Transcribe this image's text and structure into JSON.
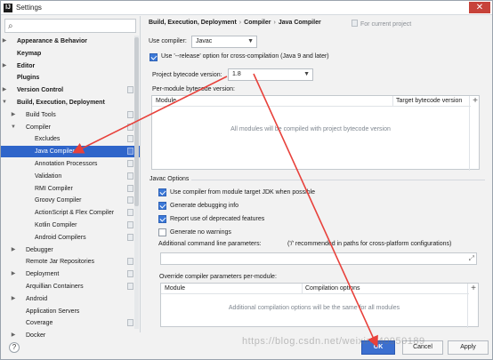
{
  "window": {
    "title": "Settings",
    "app_icon": "intellij-icon",
    "close_icon": "close-icon"
  },
  "sidebar": {
    "search_icon": "search-icon",
    "items": [
      {
        "label": "Appearance & Behavior",
        "level": 0,
        "arrow": "right",
        "bold": true,
        "project": false
      },
      {
        "label": "Keymap",
        "level": 0,
        "arrow": "",
        "bold": true,
        "project": false
      },
      {
        "label": "Editor",
        "level": 0,
        "arrow": "right",
        "bold": true,
        "project": false
      },
      {
        "label": "Plugins",
        "level": 0,
        "arrow": "",
        "bold": true,
        "project": false
      },
      {
        "label": "Version Control",
        "level": 0,
        "arrow": "right",
        "bold": true,
        "project": true
      },
      {
        "label": "Build, Execution, Deployment",
        "level": 0,
        "arrow": "down",
        "bold": true,
        "project": false
      },
      {
        "label": "Build Tools",
        "level": 1,
        "arrow": "right",
        "bold": false,
        "project": true
      },
      {
        "label": "Compiler",
        "level": 1,
        "arrow": "down",
        "bold": false,
        "project": true
      },
      {
        "label": "Excludes",
        "level": 2,
        "arrow": "",
        "bold": false,
        "project": true
      },
      {
        "label": "Java Compiler",
        "level": 2,
        "arrow": "",
        "bold": false,
        "project": true,
        "selected": true
      },
      {
        "label": "Annotation Processors",
        "level": 2,
        "arrow": "",
        "bold": false,
        "project": true
      },
      {
        "label": "Validation",
        "level": 2,
        "arrow": "",
        "bold": false,
        "project": true
      },
      {
        "label": "RMI Compiler",
        "level": 2,
        "arrow": "",
        "bold": false,
        "project": true
      },
      {
        "label": "Groovy Compiler",
        "level": 2,
        "arrow": "",
        "bold": false,
        "project": true
      },
      {
        "label": "ActionScript & Flex Compiler",
        "level": 2,
        "arrow": "",
        "bold": false,
        "project": true
      },
      {
        "label": "Kotlin Compiler",
        "level": 2,
        "arrow": "",
        "bold": false,
        "project": true
      },
      {
        "label": "Android Compilers",
        "level": 2,
        "arrow": "",
        "bold": false,
        "project": true
      },
      {
        "label": "Debugger",
        "level": 1,
        "arrow": "right",
        "bold": false,
        "project": false
      },
      {
        "label": "Remote Jar Repositories",
        "level": 1,
        "arrow": "",
        "bold": false,
        "project": true
      },
      {
        "label": "Deployment",
        "level": 1,
        "arrow": "right",
        "bold": false,
        "project": true
      },
      {
        "label": "Arquillian Containers",
        "level": 1,
        "arrow": "",
        "bold": false,
        "project": true
      },
      {
        "label": "Android",
        "level": 1,
        "arrow": "right",
        "bold": false,
        "project": false
      },
      {
        "label": "Application Servers",
        "level": 1,
        "arrow": "",
        "bold": false,
        "project": false
      },
      {
        "label": "Coverage",
        "level": 1,
        "arrow": "",
        "bold": false,
        "project": true
      },
      {
        "label": "Docker",
        "level": 1,
        "arrow": "right",
        "bold": false,
        "project": false
      }
    ]
  },
  "breadcrumb": {
    "items": [
      "Build, Execution, Deployment",
      "Compiler",
      "Java Compiler"
    ],
    "separator": "›",
    "note": "For current project"
  },
  "use_compiler": {
    "label": "Use compiler:",
    "value": "Javac"
  },
  "release_option": {
    "checked": true,
    "label": "Use '--release' option for cross-compilation (Java 9 and later)"
  },
  "bytecode": {
    "label": "Project bytecode version:",
    "value": "1.8"
  },
  "per_module": {
    "label": "Per-module bytecode version:",
    "col_module": "Module",
    "col_target": "Target bytecode version",
    "empty": "All modules will be compiled with project bytecode version",
    "add": "+"
  },
  "javac": {
    "section": "Javac Options",
    "options": [
      {
        "checked": true,
        "label": "Use compiler from module target JDK when possible"
      },
      {
        "checked": true,
        "label": "Generate debugging info"
      },
      {
        "checked": true,
        "label": "Report use of deprecated features"
      },
      {
        "checked": false,
        "label": "Generate no warnings"
      }
    ],
    "params_label": "Additional command line parameters:",
    "params_hint": "('/' recommended in paths for cross-platform configurations)",
    "params_value": "",
    "override_label": "Override compiler parameters per-module:",
    "col_module": "Module",
    "col_options": "Compilation options",
    "override_empty": "Additional compilation options will be the same for all modules",
    "add": "+"
  },
  "footer": {
    "help": "?",
    "ok": "OK",
    "cancel": "Cancel",
    "apply": "Apply"
  },
  "watermark": "https://blog.csdn.net/weixin_40950189",
  "colors": {
    "selection": "#2f65ca",
    "annotation_arrow": "#e8413b"
  }
}
